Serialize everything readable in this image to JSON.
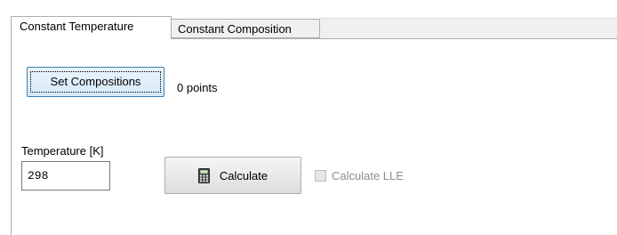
{
  "tabs": [
    {
      "label": "Constant Temperature",
      "active": true
    },
    {
      "label": "Constant Composition",
      "active": false
    }
  ],
  "compositions": {
    "button_label": "Set Compositions",
    "points_text": "0 points"
  },
  "temperature": {
    "label": "Temperature [K]",
    "value": "298"
  },
  "calculate": {
    "button_label": "Calculate",
    "icon": "calculator-icon"
  },
  "lle_checkbox": {
    "label": "Calculate LLE",
    "checked": false,
    "enabled": false
  },
  "colors": {
    "focus_border": "#3c7fb1",
    "disabled_text": "#8d8d8d",
    "tab_border": "#adadad"
  }
}
